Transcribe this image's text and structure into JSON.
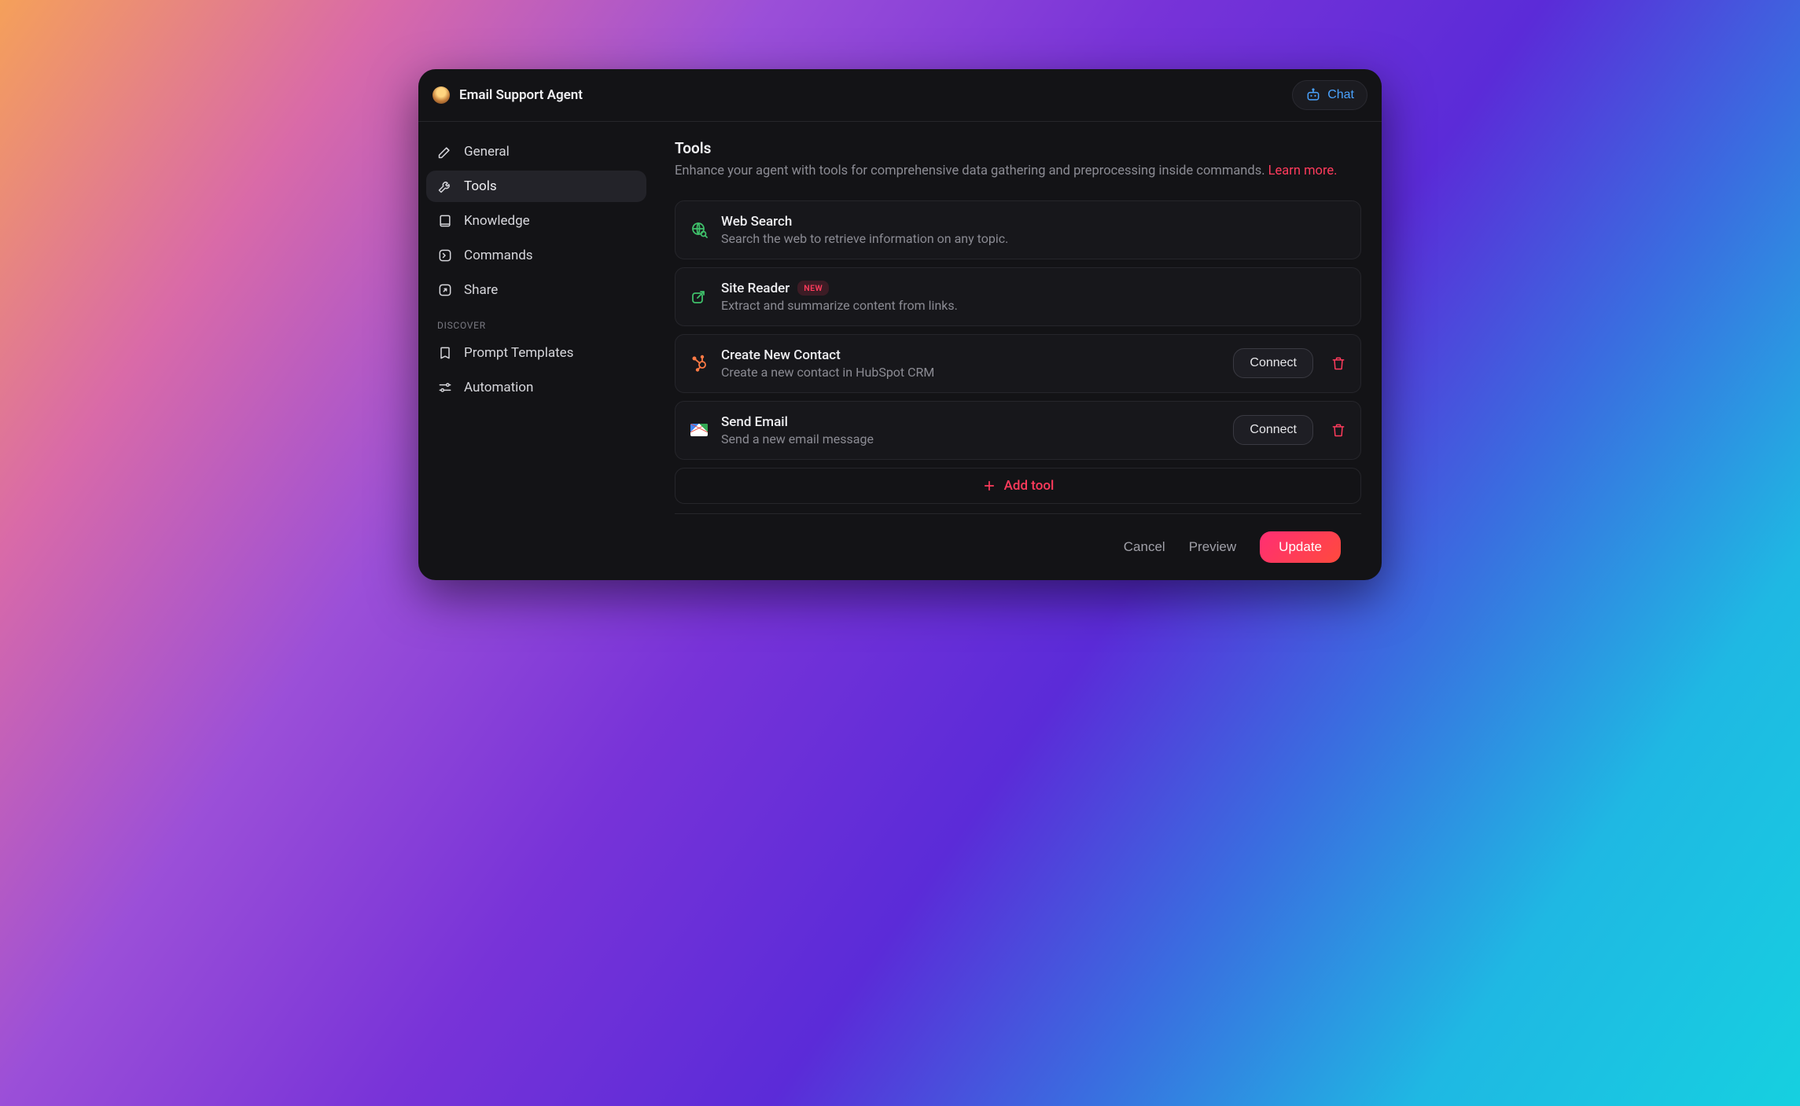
{
  "header": {
    "title": "Email Support Agent",
    "chat_label": "Chat"
  },
  "sidebar": {
    "items": [
      {
        "label": "General"
      },
      {
        "label": "Tools"
      },
      {
        "label": "Knowledge"
      },
      {
        "label": "Commands"
      },
      {
        "label": "Share"
      }
    ],
    "discover_label": "DISCOVER",
    "discover": [
      {
        "label": "Prompt Templates"
      },
      {
        "label": "Automation"
      }
    ]
  },
  "page": {
    "title": "Tools",
    "subtitle": "Enhance your agent with tools for comprehensive data gathering and preprocessing inside commands. ",
    "learn_more": "Learn more."
  },
  "tools": [
    {
      "title": "Web Search",
      "desc": "Search the web to retrieve information on any topic.",
      "badge": null,
      "connect": false,
      "deletable": false,
      "icon": "globe"
    },
    {
      "title": "Site Reader",
      "desc": "Extract and summarize content from links.",
      "badge": "NEW",
      "connect": false,
      "deletable": false,
      "icon": "external"
    },
    {
      "title": "Create New Contact",
      "desc": "Create a new contact in HubSpot CRM",
      "badge": null,
      "connect": true,
      "deletable": true,
      "icon": "hubspot"
    },
    {
      "title": "Send Email",
      "desc": "Send a new email message",
      "badge": null,
      "connect": true,
      "deletable": true,
      "icon": "gmail"
    }
  ],
  "actions": {
    "connect": "Connect",
    "add_tool": "Add tool",
    "cancel": "Cancel",
    "preview": "Preview",
    "update": "Update"
  }
}
